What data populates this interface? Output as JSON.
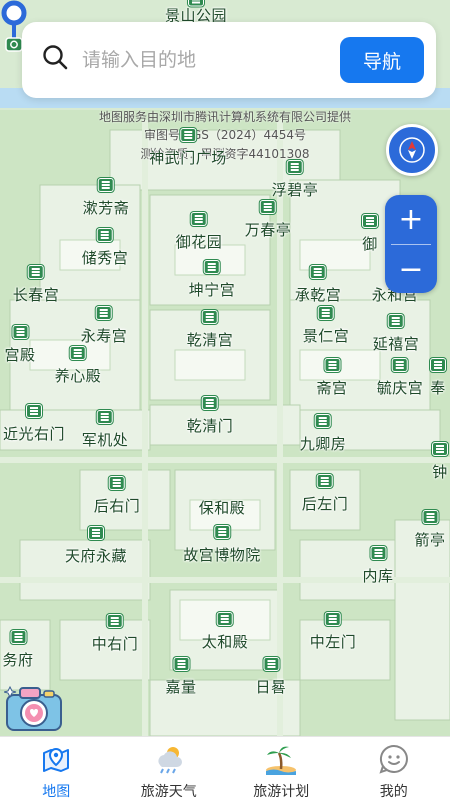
{
  "search": {
    "placeholder": "请输入目的地",
    "nav_label": "导航"
  },
  "credits": {
    "line1": "地图服务由深圳市腾讯计算机系统有限公司提供",
    "line2": "审图号：GS（2024）4454号",
    "line3": "测绘资质：甲测资字44101308"
  },
  "map_labels": {
    "jingshan": "景山公园",
    "shenwumen": "神武门广场",
    "fubiting": "浮碧亭",
    "shufangzhai": "漱芳斋",
    "wanchunting": "万春亭",
    "yuhuayuan": "御花园",
    "chuxiugong": "储秀宫",
    "kunninggong": "坤宁宫",
    "changchungong": "长春宫",
    "chengqiangong": "承乾宫",
    "yonghegong": "永和宫",
    "yongshougong": "永寿宫",
    "jingrengong": "景仁宫",
    "qianqinggong": "乾清宫",
    "yanxigong": "延禧宫",
    "gongdian": "宫殿",
    "yangxindian": "养心殿",
    "zhaigong": "斋宫",
    "yuqinggong": "毓庆宫",
    "feng": "奉",
    "jinguangyoumen": "近光右门",
    "qianqingmen": "乾清门",
    "junjichu": "军机处",
    "jiuqingfang": "九卿房",
    "zhong": "钟",
    "houyoumen": "后右门",
    "baohedian": "保和殿",
    "houzuomen": "后左门",
    "jian": "箭亭",
    "tianfuyongcang": "天府永藏",
    "gugong": "故宫博物院",
    "neiku": "内库",
    "wufu": "务府",
    "zhongyoumen": "中右门",
    "taihedian": "太和殿",
    "zhongzuomen": "中左门",
    "jialiang": "嘉量",
    "rigui": "日晷",
    "yuhua_right": "御"
  },
  "tabs": [
    {
      "label": "地图",
      "icon": "map-pin-icon",
      "active": true
    },
    {
      "label": "旅游天气",
      "icon": "weather-icon",
      "active": false
    },
    {
      "label": "旅游计划",
      "icon": "island-icon",
      "active": false
    },
    {
      "label": "我的",
      "icon": "profile-icon",
      "active": false
    }
  ],
  "colors": {
    "accent": "#1678ef",
    "map_green": "#2f8a50",
    "control_blue": "#2c6ad9"
  }
}
